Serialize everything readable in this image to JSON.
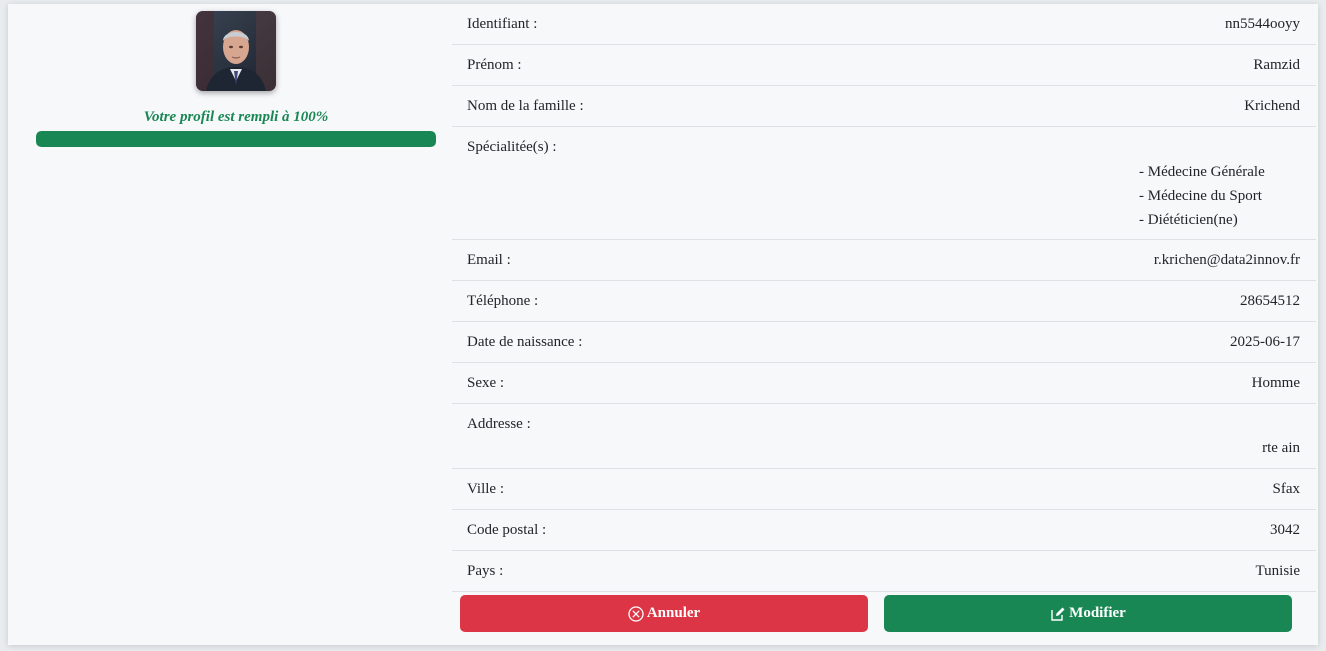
{
  "profile": {
    "completion_text": "Votre profil est rempli à 100%",
    "completion_fraction": 1.0,
    "avatar_icon": "user-photo"
  },
  "fields": {
    "identifiant": {
      "label": "Identifiant :",
      "value": "nn5544ooyy"
    },
    "prenom": {
      "label": "Prénom :",
      "value": "Ramzid"
    },
    "nom": {
      "label": "Nom de la famille :",
      "value": "Krichend"
    },
    "specialites": {
      "label": "Spécialitée(s) :",
      "items": [
        "- Médecine Générale",
        "- Médecine du Sport",
        "- Diététicien(ne)"
      ]
    },
    "email": {
      "label": "Email :",
      "value": "r.krichen@data2innov.fr"
    },
    "telephone": {
      "label": "Téléphone :",
      "value": "28654512"
    },
    "naissance": {
      "label": "Date de naissance :",
      "value": "2025-06-17"
    },
    "sexe": {
      "label": "Sexe :",
      "value": "Homme"
    },
    "adresse": {
      "label": "Addresse :",
      "value": "rte ain"
    },
    "ville": {
      "label": "Ville :",
      "value": "Sfax"
    },
    "code_postal": {
      "label": "Code postal :",
      "value": "3042"
    },
    "pays": {
      "label": "Pays :",
      "value": "Tunisie"
    }
  },
  "actions": {
    "cancel_label": "Annuler",
    "cancel_icon": "x-circle-icon",
    "edit_label": "Modifier",
    "edit_icon": "pencil-square-icon"
  },
  "colors": {
    "success": "#198754",
    "danger": "#dc3545"
  }
}
